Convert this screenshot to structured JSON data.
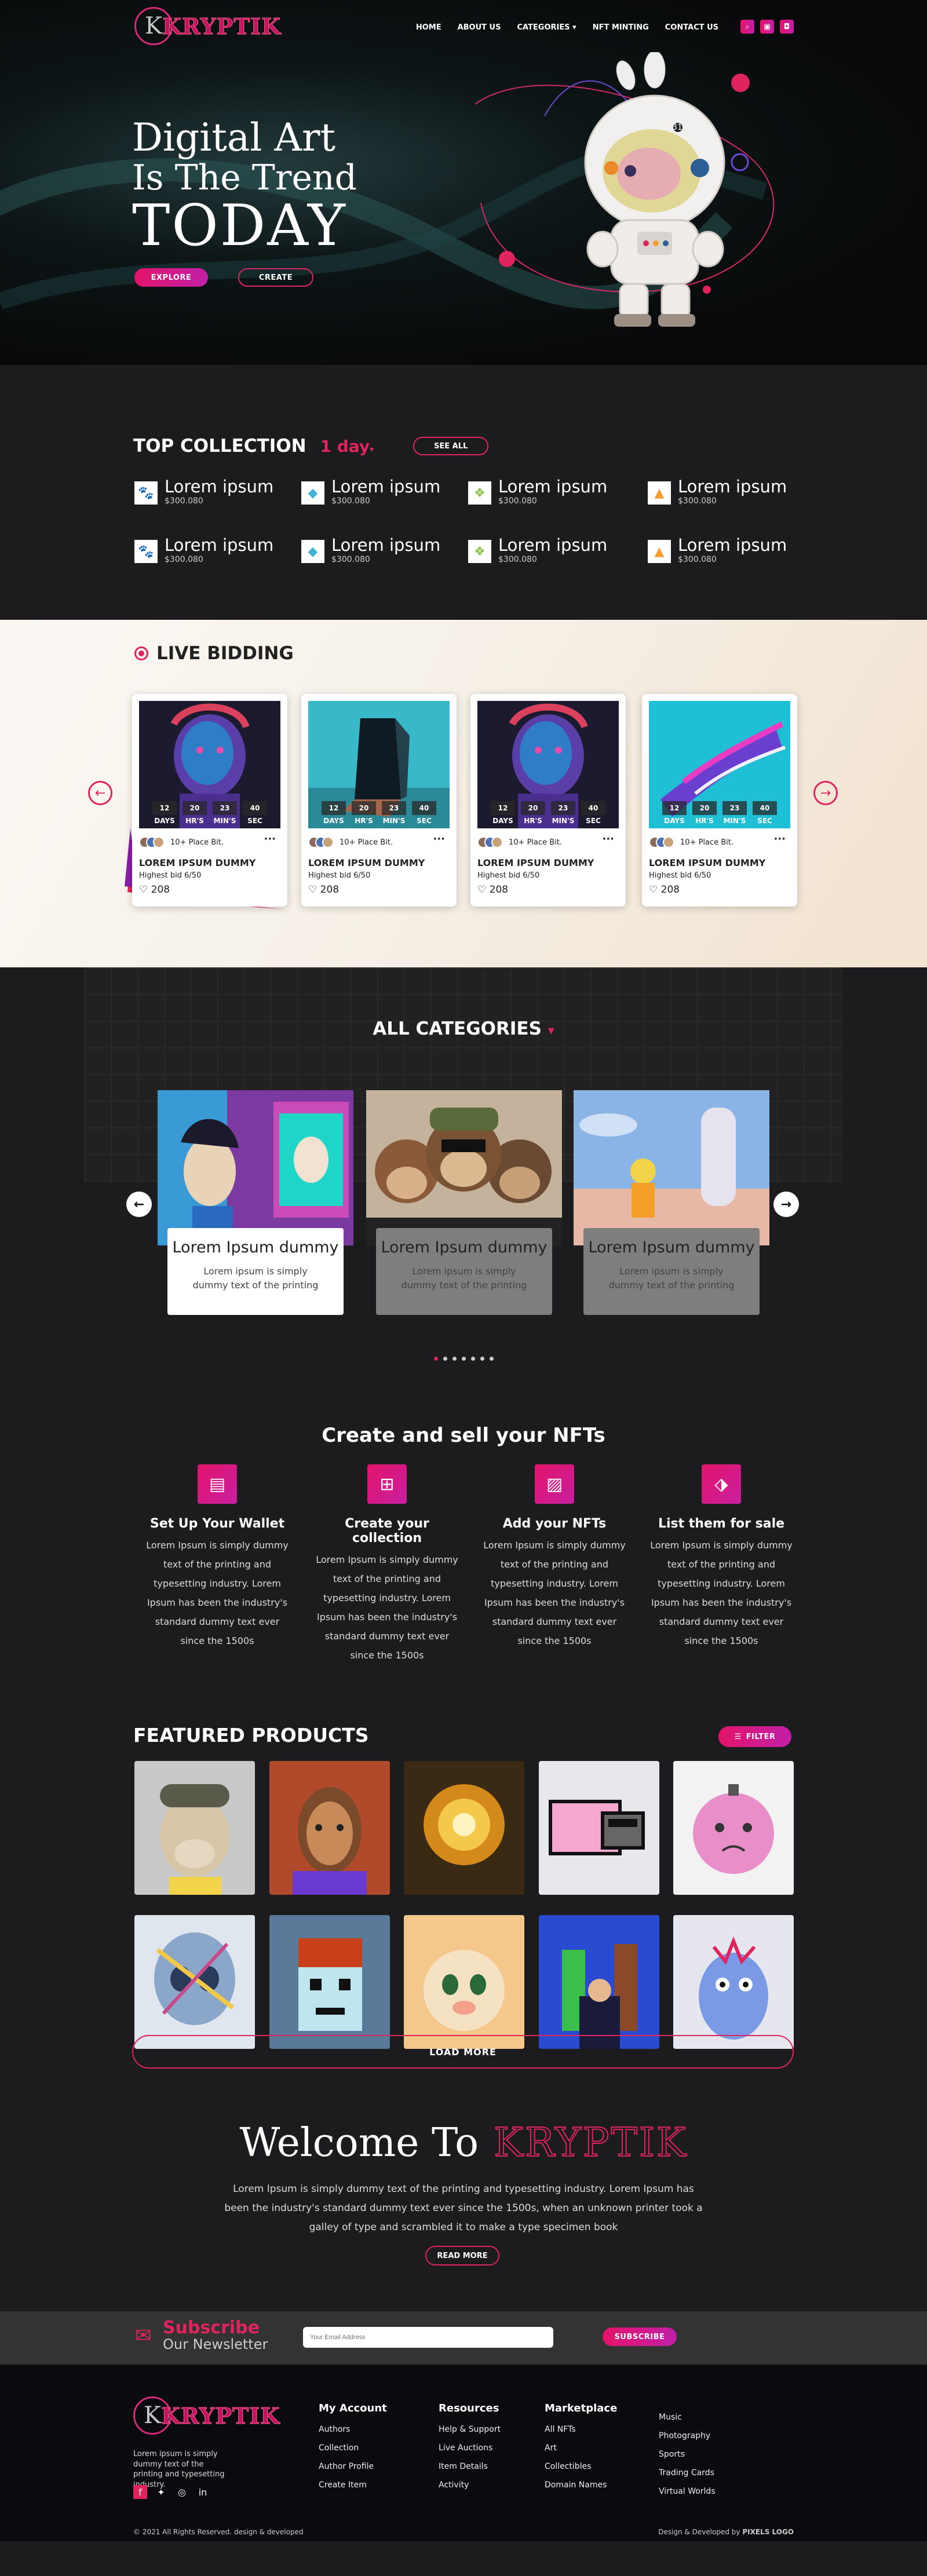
{
  "brand": {
    "logo_letter": "K",
    "logo_text": "KRYPTIK",
    "colors": {
      "accent": "#e0245e",
      "gradient_start": "#e3146a",
      "gradient_end": "#c21fa8",
      "background": "#1c1c1e"
    }
  },
  "nav": {
    "items": [
      "HOME",
      "ABOUT US",
      "CATEGORIES",
      "NFT MINTING",
      "CONTACT US"
    ],
    "categories_caret": "▾",
    "icons": [
      "search-icon",
      "wallet-icon",
      "bag-icon"
    ]
  },
  "hero": {
    "line1": "Digital Art",
    "line2": "Is The Trend",
    "line3": "TODAY",
    "explore_label": "EXPLORE",
    "create_label": "CREATE",
    "astronaut_number": "31"
  },
  "top_collection": {
    "title": "TOP COLLECTION",
    "period": "1 day",
    "period_caret": "▾",
    "see_all_label": "SEE ALL",
    "items": [
      {
        "name": "Lorem ipsum",
        "price": "$300.080",
        "icon": "paw-icon",
        "icon_color": "#d56bb3"
      },
      {
        "name": "Lorem ipsum",
        "price": "$300.080",
        "icon": "drop-icon",
        "icon_color": "#3fb3d6"
      },
      {
        "name": "Lorem ipsum",
        "price": "$300.080",
        "icon": "leaf-icon",
        "icon_color": "#8bc34a"
      },
      {
        "name": "Lorem ipsum",
        "price": "$300.080",
        "icon": "flame-icon",
        "icon_color": "#f4a031"
      },
      {
        "name": "Lorem ipsum",
        "price": "$300.080",
        "icon": "paw-icon",
        "icon_color": "#d56bb3"
      },
      {
        "name": "Lorem ipsum",
        "price": "$300.080",
        "icon": "drop-icon",
        "icon_color": "#3fb3d6"
      },
      {
        "name": "Lorem ipsum",
        "price": "$300.080",
        "icon": "leaf-icon",
        "icon_color": "#8bc34a"
      },
      {
        "name": "Lorem ipsum",
        "price": "$300.080",
        "icon": "flame-icon",
        "icon_color": "#f4a031"
      }
    ]
  },
  "live_bidding": {
    "title": "LIVE BIDDING",
    "cards": [
      {
        "countdown": [
          "12",
          "20",
          "23",
          "40"
        ],
        "units": [
          "DAYS",
          "HR'S",
          "MIN'S",
          "SEC"
        ],
        "place": "10+ Place Bit.",
        "name": "LOREM IPSUM DUMMY",
        "bid": "Highest bid 6/50",
        "likes": "208",
        "art": "bust-blue"
      },
      {
        "countdown": [
          "12",
          "20",
          "23",
          "40"
        ],
        "units": [
          "DAYS",
          "HR'S",
          "MIN'S",
          "SEC"
        ],
        "place": "10+ Place Bit.",
        "name": "LOREM IPSUM DUMMY",
        "bid": "Highest bid 6/50",
        "likes": "208",
        "art": "prism"
      },
      {
        "countdown": [
          "12",
          "20",
          "23",
          "40"
        ],
        "units": [
          "DAYS",
          "HR'S",
          "MIN'S",
          "SEC"
        ],
        "place": "10+ Place Bit.",
        "name": "LOREM IPSUM DUMMY",
        "bid": "Highest bid 6/50",
        "likes": "208",
        "art": "bust-blue"
      },
      {
        "countdown": [
          "12",
          "20",
          "23",
          "40"
        ],
        "units": [
          "DAYS",
          "HR'S",
          "MIN'S",
          "SEC"
        ],
        "place": "10+ Place Bit.",
        "name": "LOREM IPSUM DUMMY",
        "bid": "Highest bid 6/50",
        "likes": "208",
        "art": "hand"
      }
    ]
  },
  "categories": {
    "title": "ALL CATEGORIES",
    "caret": "▾",
    "cards": [
      {
        "title": "Lorem Ipsum dummy",
        "text": "Lorem ipsum is simply dummy text of the printing"
      },
      {
        "title": "Lorem Ipsum dummy",
        "text": "Lorem ipsum is simply dummy text of the printing"
      },
      {
        "title": "Lorem Ipsum dummy",
        "text": "Lorem ipsum is simply dummy text of the printing"
      }
    ],
    "active_page": 0,
    "page_count": 7
  },
  "create_sell": {
    "title": "Create and sell your NFTs",
    "steps": [
      {
        "icon": "wallet-icon",
        "title": "Set Up Your Wallet",
        "text": "Lorem Ipsum is simply dummy text of the printing and typesetting industry. Lorem Ipsum has been the industry's standard dummy text ever since the 1500s"
      },
      {
        "icon": "collection-icon",
        "title": "Create your collection",
        "text": "Lorem Ipsum is simply dummy text of the printing and typesetting industry. Lorem Ipsum has been the industry's standard dummy text ever since the 1500s"
      },
      {
        "icon": "image-icon",
        "title": "Add your NFTs",
        "text": "Lorem Ipsum is simply dummy text of the printing and typesetting industry. Lorem Ipsum has been the industry's standard dummy text ever since the 1500s"
      },
      {
        "icon": "tag-icon",
        "title": "List them for sale",
        "text": "Lorem Ipsum is simply dummy text of the printing and typesetting industry. Lorem Ipsum has been the industry's standard dummy text ever since the 1500s"
      }
    ]
  },
  "featured": {
    "title": "FEATURED PRODUCTS",
    "filter_label": "FILTER",
    "products": [
      "ape-cap",
      "portrait-girl",
      "golden-lion",
      "nyan-cat",
      "bomb-character",
      "crystal-skull",
      "pixel-punk",
      "cute-creature",
      "comic-figures",
      "blue-monster"
    ],
    "load_more_label": "LOAD MORE"
  },
  "welcome": {
    "prefix": "Welcome To",
    "brand": "KRYPTIK",
    "text": "Lorem Ipsum is simply dummy text of the printing and typesetting industry. Lorem Ipsum has been the industry's standard dummy text ever since the 1500s, when an unknown printer took a galley of type and scrambled it to make a type specimen book",
    "read_more_label": "READ MORE"
  },
  "newsletter": {
    "title": "Subscribe",
    "subtitle": "Our Newsletter",
    "placeholder": "Your Email Address",
    "button_label": "SUBSCRIBE"
  },
  "footer": {
    "about": "Lorem ipsum is simply dummy text of the printing and typesetting industry.",
    "social": [
      "facebook-icon",
      "twitter-icon",
      "instagram-icon",
      "linkedin-icon"
    ],
    "my_account": {
      "title": "My Account",
      "items": [
        "Authors",
        "Collection",
        "Author Profile",
        "Create Item"
      ]
    },
    "resources": {
      "title": "Resources",
      "items": [
        "Help & Support",
        "Live Auctions",
        "Item Details",
        "Activity"
      ]
    },
    "marketplace": {
      "title": "Marketplace",
      "items": [
        "All NFTs",
        "Art",
        "Collectibles",
        "Domain Names"
      ]
    },
    "extra": {
      "items": [
        "Music",
        "Photography",
        "Sports",
        "Trading Cards",
        "Virtual Worlds"
      ]
    },
    "copyright": "© 2021 All Rights Reserved. design & developed",
    "credit_prefix": "Design & Developed by",
    "credit_brand": "PIXELS LOGO"
  }
}
